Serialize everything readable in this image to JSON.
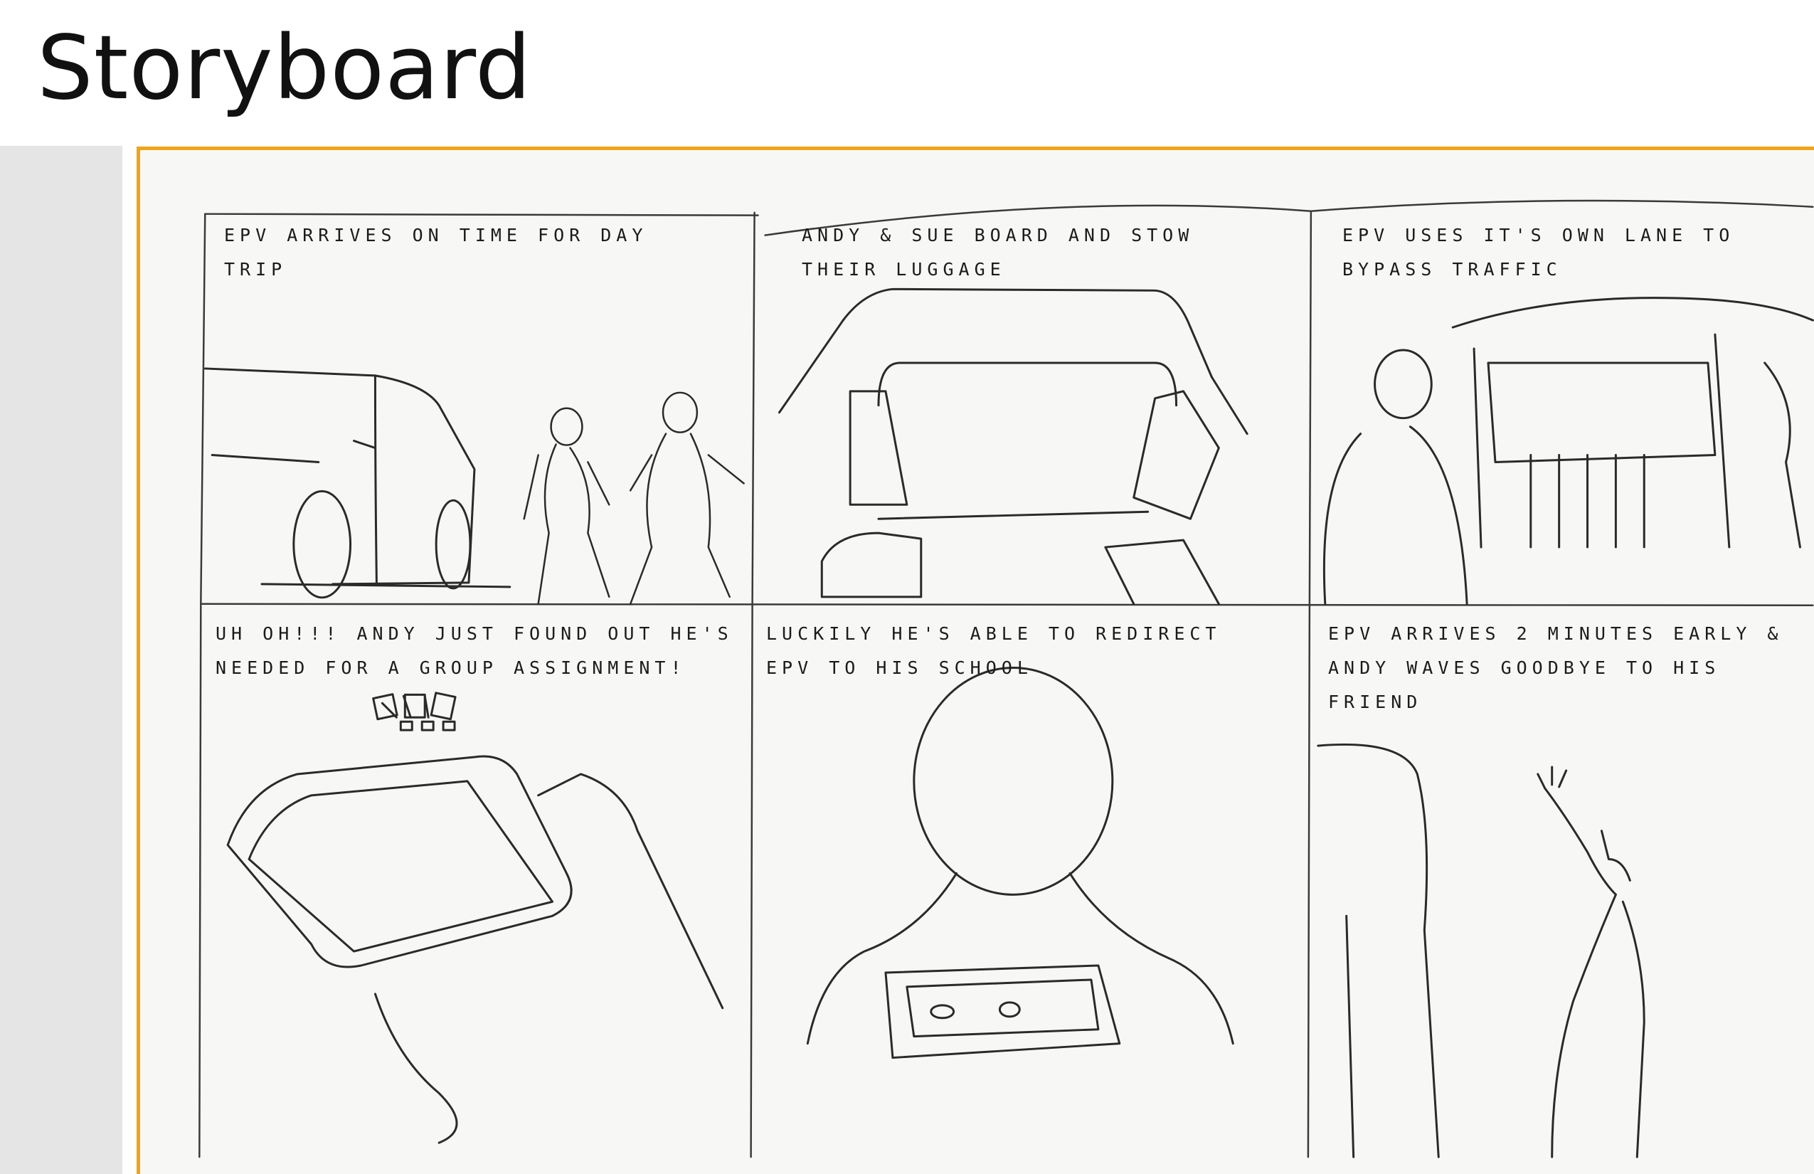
{
  "page": {
    "title": "Storyboard"
  },
  "colors": {
    "accent": "#f0a418",
    "sidebar": "#e5e5e5",
    "paper": "#f7f7f6",
    "ink": "#1b1b1b"
  },
  "panels": [
    {
      "caption": "EPV ARRIVES ON TIME FOR DAY TRIP"
    },
    {
      "caption": "ANDY & SUE BOARD AND STOW THEIR LUGGAGE"
    },
    {
      "caption": "EPV USES IT'S OWN LANE TO BYPASS TRAFFIC"
    },
    {
      "caption": "UH OH!!! ANDY JUST FOUND OUT HE'S NEEDED FOR A GROUP ASSIGNMENT!"
    },
    {
      "caption": "LUCKILY HE'S ABLE TO REDIRECT EPV TO HIS SCHOOL"
    },
    {
      "caption": "EPV ARRIVES 2 MINUTES EARLY & ANDY WAVES GOODBYE TO HIS FRIEND"
    }
  ]
}
